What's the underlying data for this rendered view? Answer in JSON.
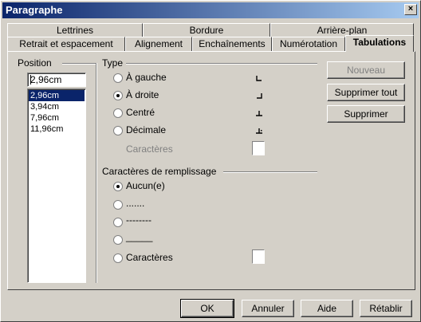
{
  "window": {
    "title": "Paragraphe",
    "close_glyph": "×"
  },
  "tabs": {
    "row1": [
      "Lettrines",
      "Bordure",
      "Arrière-plan"
    ],
    "row2": [
      "Retrait et espacement",
      "Alignement",
      "Enchaînements",
      "Numérotation",
      "Tabulations"
    ],
    "active": "Tabulations"
  },
  "position": {
    "label": "Position",
    "input_value": "2,96cm",
    "list": [
      "2,96cm",
      "3,94cm",
      "7,96cm",
      "11,96cm"
    ],
    "selected": "2,96cm"
  },
  "type": {
    "label": "Type",
    "options": [
      "À gauche",
      "À droite",
      "Centré",
      "Décimale"
    ],
    "selected": "À droite",
    "characters_label": "Caractères"
  },
  "fill": {
    "label": "Caractères de remplissage",
    "options": [
      "Aucun(e)",
      ".......",
      "--------",
      "_____",
      "Caractères"
    ],
    "selected": "Aucun(e)"
  },
  "side_buttons": {
    "new": "Nouveau",
    "delete_all": "Supprimer tout",
    "delete": "Supprimer"
  },
  "footer": {
    "ok": "OK",
    "cancel": "Annuler",
    "help": "Aide",
    "reset": "Rétablir"
  }
}
